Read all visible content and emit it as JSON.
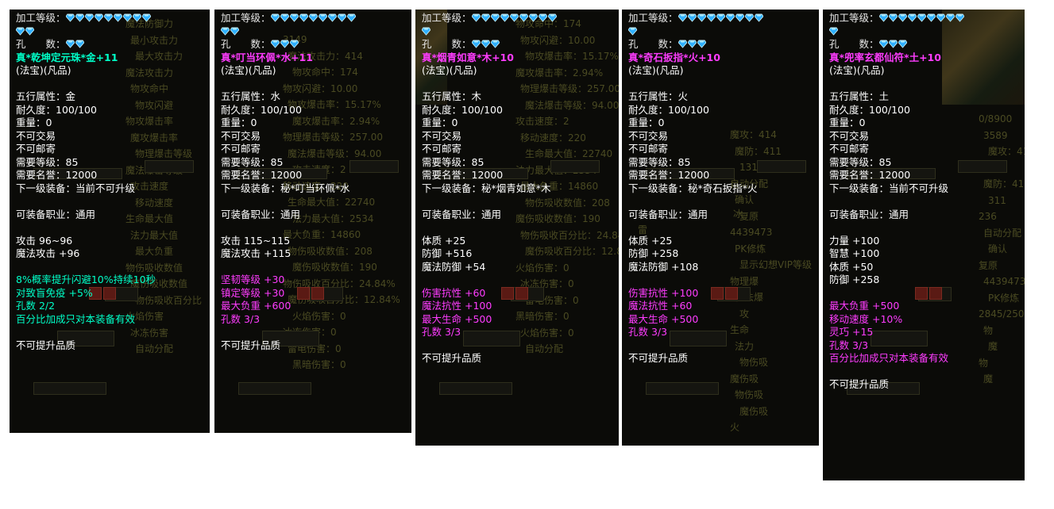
{
  "colors": {
    "panel_bg": "#0b0b08",
    "text": "#e8e8e8",
    "cyan": "#00ffc8",
    "magenta": "#ff3cff",
    "gem": "#2fb0ff",
    "background_text": "#4a4a22"
  },
  "panels": [
    {
      "processing_label": "加工等级：",
      "gem_rows": [
        9,
        2
      ],
      "hole_label": "孔　　数：",
      "hole_gems": 2,
      "name": "真*乾坤定元珠*金+11",
      "name_color": "cyan",
      "type": "(法宝)(凡品)",
      "base": [
        "五行属性：金",
        "耐久度：100/100",
        "重量：0",
        "不可交易",
        "不可邮寄",
        "需要等级：85",
        "需要名誉：12000",
        "下一级装备：当前不可升级"
      ],
      "job": "可装备职业：通用",
      "attrs": [
        "攻击 96~96",
        "魔法攻击 +96"
      ],
      "specials": [
        {
          "text": "8%概率提升闪避10%持续10秒",
          "color": "cyan"
        },
        {
          "text": "对致盲免疫 +5%",
          "color": "cyan"
        },
        {
          "text": "孔数 2/2",
          "color": "cyan"
        },
        {
          "text": "百分比加成只对本装备有效",
          "color": "cyan"
        }
      ],
      "footer": "不可提升品质",
      "bg_texts": [
        "魔法防御力",
        "最小攻击力",
        "最大攻击力",
        "魔法攻击力",
        "物攻命中",
        "物攻闪避",
        "物攻爆击率",
        "魔攻爆击率",
        "物理爆击等级",
        "魔法爆击等级",
        "攻击速度",
        "移动速度",
        "生命最大值",
        "法力最大值",
        "最大负重",
        "物伤吸收数值",
        "魔伤吸收数值",
        "物伤吸收百分比",
        "火焰伤害",
        "冰冻伤害",
        "自动分配"
      ]
    },
    {
      "processing_label": "加工等级：",
      "gem_rows": [
        9,
        2
      ],
      "hole_label": "孔　　数：",
      "hole_gems": 3,
      "name": "真*叮当环佩*水+11",
      "name_color": "magenta",
      "type": "(法宝)(凡品)",
      "base": [
        "五行属性：水",
        "耐久度：100/100",
        "重量：0",
        "不可交易",
        "不可邮寄",
        "需要等级：85",
        "需要名誉：12000",
        "下一级装备：秘*叮当环佩*水"
      ],
      "job": "可装备职业：通用",
      "attrs": [
        "攻击 115~115",
        "魔法攻击 +115"
      ],
      "specials": [
        {
          "text": "坚韧等级 +30",
          "color": "magenta"
        },
        {
          "text": "镇定等级 +30",
          "color": "magenta"
        },
        {
          "text": "最大负重 +600",
          "color": "magenta"
        },
        {
          "text": "孔数 3/3",
          "color": "magenta"
        }
      ],
      "footer": "不可提升品质",
      "bg_texts": [
        "3149",
        "魔法攻击力：414",
        "物攻命中：174",
        "物攻闪避：10.00",
        "物攻爆击率：15.17%",
        "魔攻爆击率：2.94%",
        "物理爆击等级：257.00",
        "魔法爆击等级：94.00",
        "攻击速度：2",
        "移动速度：220",
        "生命最大值：22740",
        "法力最大值：2534",
        "最大负重：14860",
        "物伤吸收数值：208",
        "魔伤吸收数值：190",
        "物伤吸收百分比：24.84%",
        "魔伤吸收百分比：12.84%",
        "火焰伤害：0",
        "冰冻伤害：0",
        "雷电伤害：0",
        "黑暗伤害：0"
      ]
    },
    {
      "processing_label": "加工等级：",
      "gem_rows": [
        9,
        1
      ],
      "hole_label": "孔　　数：",
      "hole_gems": 3,
      "name": "真*烟青如意*木+10",
      "name_color": "magenta",
      "type": "(法宝)(凡品)",
      "base": [
        "五行属性：木",
        "耐久度：100/100",
        "重量：0",
        "不可交易",
        "不可邮寄",
        "需要等级：85",
        "需要名誉：12000",
        "下一级装备：秘*烟青如意*木"
      ],
      "job": "可装备职业：通用",
      "attrs": [
        "体质 +25",
        "防御 +516",
        "魔法防御 +54"
      ],
      "specials": [
        {
          "text": "伤害抗性 +60",
          "color": "magenta"
        },
        {
          "text": "魔法抗性 +100",
          "color": "magenta"
        },
        {
          "text": "最大生命 +500",
          "color": "magenta"
        },
        {
          "text": "孔数 3/3",
          "color": "magenta"
        }
      ],
      "footer": "不可提升品质",
      "bg_texts": [
        "物攻命中：174",
        "物攻闪避：10.00",
        "物攻爆击率：15.17%",
        "魔攻爆击率：2.94%",
        "物理爆击等级：257.00",
        "魔法爆击等级：94.00",
        "攻击速度：2",
        "移动速度：220",
        "生命最大值：22740",
        "法力最大值：2534",
        "最大负重：14860",
        "物伤吸收数值：208",
        "魔伤吸收数值：190",
        "物伤吸收百分比：24.84%",
        "魔伤吸收百分比：12.84%",
        "火焰伤害：0",
        "冰冻伤害：0",
        "雷电伤害：0",
        "黑暗伤害：0",
        "火焰伤害：0",
        "自动分配"
      ]
    },
    {
      "processing_label": "加工等级：",
      "gem_rows": [
        9,
        1
      ],
      "hole_label": "孔　　数：",
      "hole_gems": 3,
      "name": "真*奇石扳指*火+10",
      "name_color": "magenta",
      "type": "(法宝)(凡品)",
      "base": [
        "五行属性：火",
        "耐久度：100/100",
        "重量：0",
        "不可交易",
        "不可邮寄",
        "需要等级：85",
        "需要名誉：12000",
        "下一级装备：秘*奇石扳指*火"
      ],
      "job": "可装备职业：通用",
      "attrs": [
        "体质 +25",
        "防御 +258",
        "魔法防御 +108"
      ],
      "specials": [
        {
          "text": "伤害抗性 +100",
          "color": "magenta"
        },
        {
          "text": "魔法抗性 +60",
          "color": "magenta"
        },
        {
          "text": "最大生命 +500",
          "color": "magenta"
        },
        {
          "text": "孔数 3/3",
          "color": "magenta"
        }
      ],
      "footer": "不可提升品质",
      "bg_texts": [
        "魔攻：414",
        "魔防：411",
        "1311",
        "自动分配",
        "确认",
        "复原",
        "4439473",
        "PK修炼",
        "显示幻想VIP等级",
        "物理爆",
        "魔法爆",
        "攻",
        "生命",
        "法力",
        "物伤吸",
        "魔伤吸",
        "物伤吸",
        "魔伤吸",
        "火",
        "冰",
        "雷"
      ]
    },
    {
      "processing_label": "加工等级：",
      "gem_rows": [
        9,
        1
      ],
      "hole_label": "孔　　数：",
      "hole_gems": 3,
      "name": "真*兜率玄都仙符*土+10",
      "name_color": "magenta",
      "type": "(法宝)(凡品)",
      "base": [
        "五行属性：土",
        "耐久度：100/100",
        "重量：0",
        "不可交易",
        "不可邮寄",
        "需要等级：85",
        "需要名誉：12000",
        "下一级装备：当前不可升级"
      ],
      "job": "可装备职业：通用",
      "attrs": [
        "力量 +100",
        "智慧 +100",
        "体质 +50",
        "防御 +258"
      ],
      "specials": [
        {
          "text": "最大负重 +500",
          "color": "magenta"
        },
        {
          "text": "移动速度 +10%",
          "color": "magenta"
        },
        {
          "text": "灵巧 +15",
          "color": "magenta"
        },
        {
          "text": "孔数 3/3",
          "color": "magenta"
        },
        {
          "text": "百分比加成只对本装备有效",
          "color": "magenta"
        }
      ],
      "footer": "不可提升品质",
      "bg_texts": [
        "0/8900",
        "3589",
        "魔攻：414",
        "174",
        "魔防：411",
        "311",
        "236",
        "自动分配",
        "确认",
        "复原",
        "4439473",
        "PK修炼",
        "2845/2500000000",
        "物",
        "魔",
        "物",
        "魔"
      ]
    }
  ]
}
